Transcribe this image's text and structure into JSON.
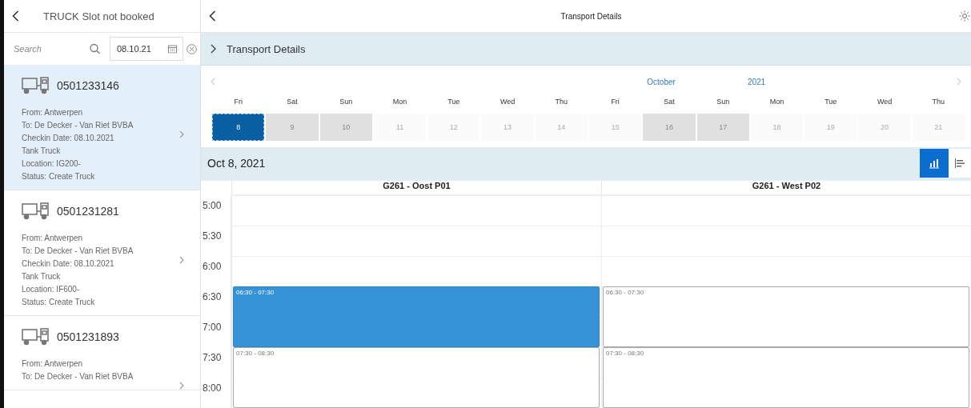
{
  "master": {
    "title": "TRUCK Slot not booked",
    "search": {
      "placeholder": "Search"
    },
    "date_filter": {
      "value": "08.10.21"
    },
    "items": [
      {
        "number": "0501233146",
        "selected": true,
        "lines": [
          "From: Antwerpen",
          "To: De Decker - Van Riet BVBA",
          "Checkin Date: 08.10.2021",
          "Tank Truck",
          "Location: IG200-",
          "Status: Create Truck"
        ]
      },
      {
        "number": "0501231281",
        "selected": false,
        "lines": [
          "From: Antwerpen",
          "To: De Decker - Van Riet BVBA",
          "Checkin Date: 08.10.2021",
          "Tank Truck",
          "Location: IF600-",
          "Status: Create Truck"
        ]
      },
      {
        "number": "0501231893",
        "selected": false,
        "lines": [
          "From: Antwerpen",
          "To: De Decker - Van Riet BVBA"
        ]
      }
    ]
  },
  "detail": {
    "title": "Transport Details",
    "section": {
      "title": "Transport Details",
      "expanded": false
    },
    "calendar": {
      "month": "October",
      "year": "2021",
      "days": [
        {
          "weekday": "Fri",
          "date": "8",
          "selected": true,
          "weekend": false
        },
        {
          "weekday": "Sat",
          "date": "9",
          "selected": false,
          "weekend": true
        },
        {
          "weekday": "Sun",
          "date": "10",
          "selected": false,
          "weekend": true
        },
        {
          "weekday": "Mon",
          "date": "11",
          "selected": false,
          "weekend": false
        },
        {
          "weekday": "Tue",
          "date": "12",
          "selected": false,
          "weekend": false
        },
        {
          "weekday": "Wed",
          "date": "13",
          "selected": false,
          "weekend": false
        },
        {
          "weekday": "Thu",
          "date": "14",
          "selected": false,
          "weekend": false
        },
        {
          "weekday": "Fri",
          "date": "15",
          "selected": false,
          "weekend": false
        },
        {
          "weekday": "Sat",
          "date": "16",
          "selected": false,
          "weekend": true
        },
        {
          "weekday": "Sun",
          "date": "17",
          "selected": false,
          "weekend": true
        },
        {
          "weekday": "Mon",
          "date": "18",
          "selected": false,
          "weekend": false
        },
        {
          "weekday": "Tue",
          "date": "19",
          "selected": false,
          "weekend": false
        },
        {
          "weekday": "Wed",
          "date": "20",
          "selected": false,
          "weekend": false
        },
        {
          "weekday": "Thu",
          "date": "21",
          "selected": false,
          "weekend": false
        }
      ]
    },
    "planning": {
      "date": "Oct 8, 2021",
      "views": [
        {
          "kind": "chart",
          "selected": true
        },
        {
          "kind": "list",
          "selected": false
        }
      ],
      "times": [
        "5:00",
        "5:30",
        "6:00",
        "6:30",
        "7:00",
        "7:30",
        "8:00"
      ],
      "columns": [
        {
          "name": "G261 - Oost P01",
          "slots": [
            {
              "time": "06:30 - 07:30",
              "selected": true
            },
            {
              "time": "07:30 - 08:30",
              "selected": false
            }
          ]
        },
        {
          "name": "G261 - West P02",
          "slots": [
            {
              "time": "06:30 - 07:30",
              "selected": false
            },
            {
              "time": "07:30 - 08:30",
              "selected": false
            }
          ]
        }
      ]
    }
  }
}
